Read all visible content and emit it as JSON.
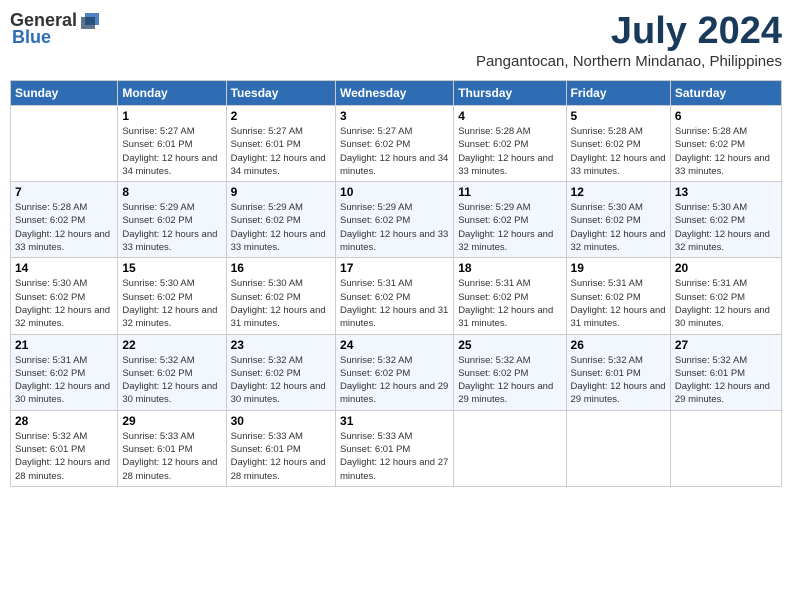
{
  "logo": {
    "general": "General",
    "blue": "Blue"
  },
  "header": {
    "month_title": "July 2024",
    "location": "Pangantocan, Northern Mindanao, Philippines"
  },
  "days_of_week": [
    "Sunday",
    "Monday",
    "Tuesday",
    "Wednesday",
    "Thursday",
    "Friday",
    "Saturday"
  ],
  "weeks": [
    [
      {
        "day": "",
        "sunrise": "",
        "sunset": "",
        "daylight": ""
      },
      {
        "day": "1",
        "sunrise": "Sunrise: 5:27 AM",
        "sunset": "Sunset: 6:01 PM",
        "daylight": "Daylight: 12 hours and 34 minutes."
      },
      {
        "day": "2",
        "sunrise": "Sunrise: 5:27 AM",
        "sunset": "Sunset: 6:01 PM",
        "daylight": "Daylight: 12 hours and 34 minutes."
      },
      {
        "day": "3",
        "sunrise": "Sunrise: 5:27 AM",
        "sunset": "Sunset: 6:02 PM",
        "daylight": "Daylight: 12 hours and 34 minutes."
      },
      {
        "day": "4",
        "sunrise": "Sunrise: 5:28 AM",
        "sunset": "Sunset: 6:02 PM",
        "daylight": "Daylight: 12 hours and 33 minutes."
      },
      {
        "day": "5",
        "sunrise": "Sunrise: 5:28 AM",
        "sunset": "Sunset: 6:02 PM",
        "daylight": "Daylight: 12 hours and 33 minutes."
      },
      {
        "day": "6",
        "sunrise": "Sunrise: 5:28 AM",
        "sunset": "Sunset: 6:02 PM",
        "daylight": "Daylight: 12 hours and 33 minutes."
      }
    ],
    [
      {
        "day": "7",
        "sunrise": "Sunrise: 5:28 AM",
        "sunset": "Sunset: 6:02 PM",
        "daylight": "Daylight: 12 hours and 33 minutes."
      },
      {
        "day": "8",
        "sunrise": "Sunrise: 5:29 AM",
        "sunset": "Sunset: 6:02 PM",
        "daylight": "Daylight: 12 hours and 33 minutes."
      },
      {
        "day": "9",
        "sunrise": "Sunrise: 5:29 AM",
        "sunset": "Sunset: 6:02 PM",
        "daylight": "Daylight: 12 hours and 33 minutes."
      },
      {
        "day": "10",
        "sunrise": "Sunrise: 5:29 AM",
        "sunset": "Sunset: 6:02 PM",
        "daylight": "Daylight: 12 hours and 33 minutes."
      },
      {
        "day": "11",
        "sunrise": "Sunrise: 5:29 AM",
        "sunset": "Sunset: 6:02 PM",
        "daylight": "Daylight: 12 hours and 32 minutes."
      },
      {
        "day": "12",
        "sunrise": "Sunrise: 5:30 AM",
        "sunset": "Sunset: 6:02 PM",
        "daylight": "Daylight: 12 hours and 32 minutes."
      },
      {
        "day": "13",
        "sunrise": "Sunrise: 5:30 AM",
        "sunset": "Sunset: 6:02 PM",
        "daylight": "Daylight: 12 hours and 32 minutes."
      }
    ],
    [
      {
        "day": "14",
        "sunrise": "Sunrise: 5:30 AM",
        "sunset": "Sunset: 6:02 PM",
        "daylight": "Daylight: 12 hours and 32 minutes."
      },
      {
        "day": "15",
        "sunrise": "Sunrise: 5:30 AM",
        "sunset": "Sunset: 6:02 PM",
        "daylight": "Daylight: 12 hours and 32 minutes."
      },
      {
        "day": "16",
        "sunrise": "Sunrise: 5:30 AM",
        "sunset": "Sunset: 6:02 PM",
        "daylight": "Daylight: 12 hours and 31 minutes."
      },
      {
        "day": "17",
        "sunrise": "Sunrise: 5:31 AM",
        "sunset": "Sunset: 6:02 PM",
        "daylight": "Daylight: 12 hours and 31 minutes."
      },
      {
        "day": "18",
        "sunrise": "Sunrise: 5:31 AM",
        "sunset": "Sunset: 6:02 PM",
        "daylight": "Daylight: 12 hours and 31 minutes."
      },
      {
        "day": "19",
        "sunrise": "Sunrise: 5:31 AM",
        "sunset": "Sunset: 6:02 PM",
        "daylight": "Daylight: 12 hours and 31 minutes."
      },
      {
        "day": "20",
        "sunrise": "Sunrise: 5:31 AM",
        "sunset": "Sunset: 6:02 PM",
        "daylight": "Daylight: 12 hours and 30 minutes."
      }
    ],
    [
      {
        "day": "21",
        "sunrise": "Sunrise: 5:31 AM",
        "sunset": "Sunset: 6:02 PM",
        "daylight": "Daylight: 12 hours and 30 minutes."
      },
      {
        "day": "22",
        "sunrise": "Sunrise: 5:32 AM",
        "sunset": "Sunset: 6:02 PM",
        "daylight": "Daylight: 12 hours and 30 minutes."
      },
      {
        "day": "23",
        "sunrise": "Sunrise: 5:32 AM",
        "sunset": "Sunset: 6:02 PM",
        "daylight": "Daylight: 12 hours and 30 minutes."
      },
      {
        "day": "24",
        "sunrise": "Sunrise: 5:32 AM",
        "sunset": "Sunset: 6:02 PM",
        "daylight": "Daylight: 12 hours and 29 minutes."
      },
      {
        "day": "25",
        "sunrise": "Sunrise: 5:32 AM",
        "sunset": "Sunset: 6:02 PM",
        "daylight": "Daylight: 12 hours and 29 minutes."
      },
      {
        "day": "26",
        "sunrise": "Sunrise: 5:32 AM",
        "sunset": "Sunset: 6:01 PM",
        "daylight": "Daylight: 12 hours and 29 minutes."
      },
      {
        "day": "27",
        "sunrise": "Sunrise: 5:32 AM",
        "sunset": "Sunset: 6:01 PM",
        "daylight": "Daylight: 12 hours and 29 minutes."
      }
    ],
    [
      {
        "day": "28",
        "sunrise": "Sunrise: 5:32 AM",
        "sunset": "Sunset: 6:01 PM",
        "daylight": "Daylight: 12 hours and 28 minutes."
      },
      {
        "day": "29",
        "sunrise": "Sunrise: 5:33 AM",
        "sunset": "Sunset: 6:01 PM",
        "daylight": "Daylight: 12 hours and 28 minutes."
      },
      {
        "day": "30",
        "sunrise": "Sunrise: 5:33 AM",
        "sunset": "Sunset: 6:01 PM",
        "daylight": "Daylight: 12 hours and 28 minutes."
      },
      {
        "day": "31",
        "sunrise": "Sunrise: 5:33 AM",
        "sunset": "Sunset: 6:01 PM",
        "daylight": "Daylight: 12 hours and 27 minutes."
      },
      {
        "day": "",
        "sunrise": "",
        "sunset": "",
        "daylight": ""
      },
      {
        "day": "",
        "sunrise": "",
        "sunset": "",
        "daylight": ""
      },
      {
        "day": "",
        "sunrise": "",
        "sunset": "",
        "daylight": ""
      }
    ]
  ]
}
